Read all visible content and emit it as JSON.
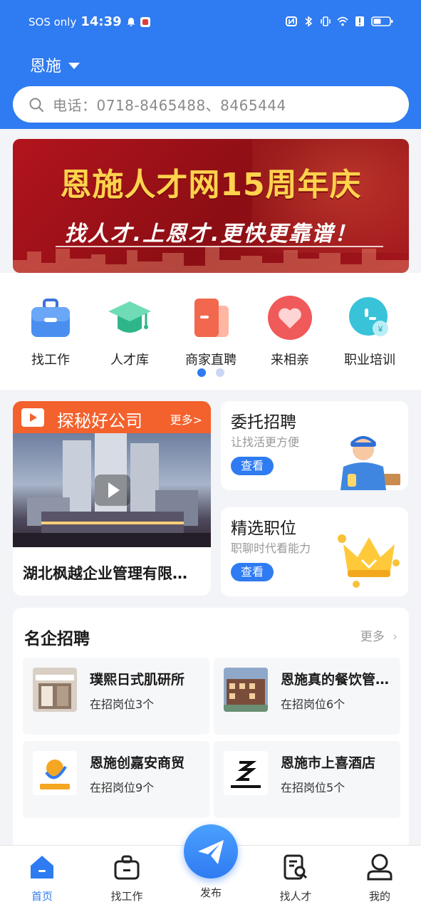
{
  "status_bar": {
    "carrier": "SOS only",
    "time": "14:39"
  },
  "header": {
    "city": "恩施",
    "search_placeholder": "电话：0718-8465488、8465444"
  },
  "banner": {
    "title": "恩施人才网15周年庆",
    "subtitle": "找人才.上恩才.更快更靠谱！"
  },
  "categories": [
    {
      "label": "找工作",
      "icon": "briefcase-icon"
    },
    {
      "label": "人才库",
      "icon": "graduation-cap-icon"
    },
    {
      "label": "商家直聘",
      "icon": "store-card-icon"
    },
    {
      "label": "来相亲",
      "icon": "heart-icon"
    },
    {
      "label": "职业培训",
      "icon": "training-icon"
    }
  ],
  "carousel": {
    "pages": 2,
    "active": 1
  },
  "explore": {
    "title": "探秘好公司",
    "more": "更多>",
    "company": "湖北枫越企业管理有限公司"
  },
  "entrust": {
    "title": "委托招聘",
    "subtitle": "让找活更方便",
    "button": "查看"
  },
  "selected": {
    "title": "精选职位",
    "subtitle": "职聊时代看能力",
    "button": "查看"
  },
  "famous": {
    "title": "名企招聘",
    "more": "更多",
    "companies": [
      {
        "name": "璞熙日式肌研所",
        "count": "在招岗位3个"
      },
      {
        "name": "恩施真的餐饮管理有限公司",
        "count": "在招岗位6个"
      },
      {
        "name": "恩施创嘉安商贸",
        "count": "在招岗位9个"
      },
      {
        "name": "恩施市上喜酒店",
        "count": "在招岗位5个"
      }
    ]
  },
  "nav": {
    "home": "首页",
    "jobs": "找工作",
    "publish": "发布",
    "talent": "找人才",
    "mine": "我的"
  },
  "colors": {
    "primary": "#2f7bf1",
    "orange": "#f3612c",
    "banner_red": "#b3141d",
    "banner_gold": "#ffd34d"
  }
}
